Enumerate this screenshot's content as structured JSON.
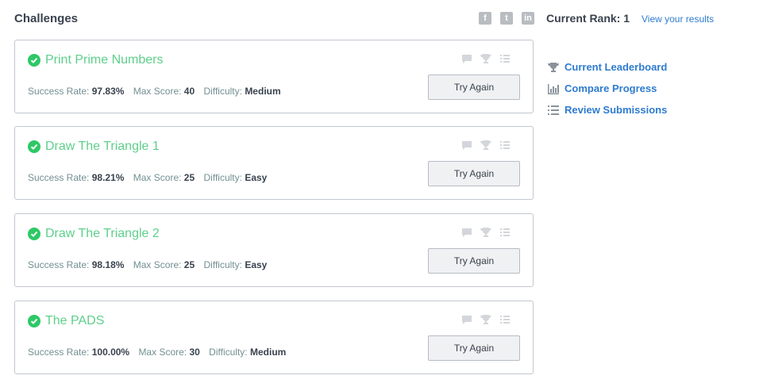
{
  "header": {
    "title": "Challenges",
    "social": [
      "f",
      "t",
      "in"
    ],
    "rank_label": "Current Rank: 1",
    "view_results": "View your results"
  },
  "challenges": [
    {
      "name": "Print Prime Numbers",
      "success_label": "Success Rate:",
      "success_rate": "97.83%",
      "max_label": "Max Score:",
      "max_score": "40",
      "difficulty_label": "Difficulty:",
      "difficulty": "Medium",
      "button": "Try Again"
    },
    {
      "name": "Draw The Triangle 1",
      "success_label": "Success Rate:",
      "success_rate": "98.21%",
      "max_label": "Max Score:",
      "max_score": "25",
      "difficulty_label": "Difficulty:",
      "difficulty": "Easy",
      "button": "Try Again"
    },
    {
      "name": "Draw The Triangle 2",
      "success_label": "Success Rate:",
      "success_rate": "98.18%",
      "max_label": "Max Score:",
      "max_score": "25",
      "difficulty_label": "Difficulty:",
      "difficulty": "Easy",
      "button": "Try Again"
    },
    {
      "name": "The PADS",
      "success_label": "Success Rate:",
      "success_rate": "100.00%",
      "max_label": "Max Score:",
      "max_score": "30",
      "difficulty_label": "Difficulty:",
      "difficulty": "Medium",
      "button": "Try Again"
    }
  ],
  "sidebar": {
    "links": [
      {
        "label": "Current Leaderboard",
        "icon": "trophy-icon"
      },
      {
        "label": "Compare Progress",
        "icon": "bar-chart-icon"
      },
      {
        "label": "Review Submissions",
        "icon": "list-icon"
      }
    ]
  },
  "colors": {
    "accent": "#2e7bcf",
    "success": "#2ec866",
    "solved_title": "#5ecf8b"
  }
}
